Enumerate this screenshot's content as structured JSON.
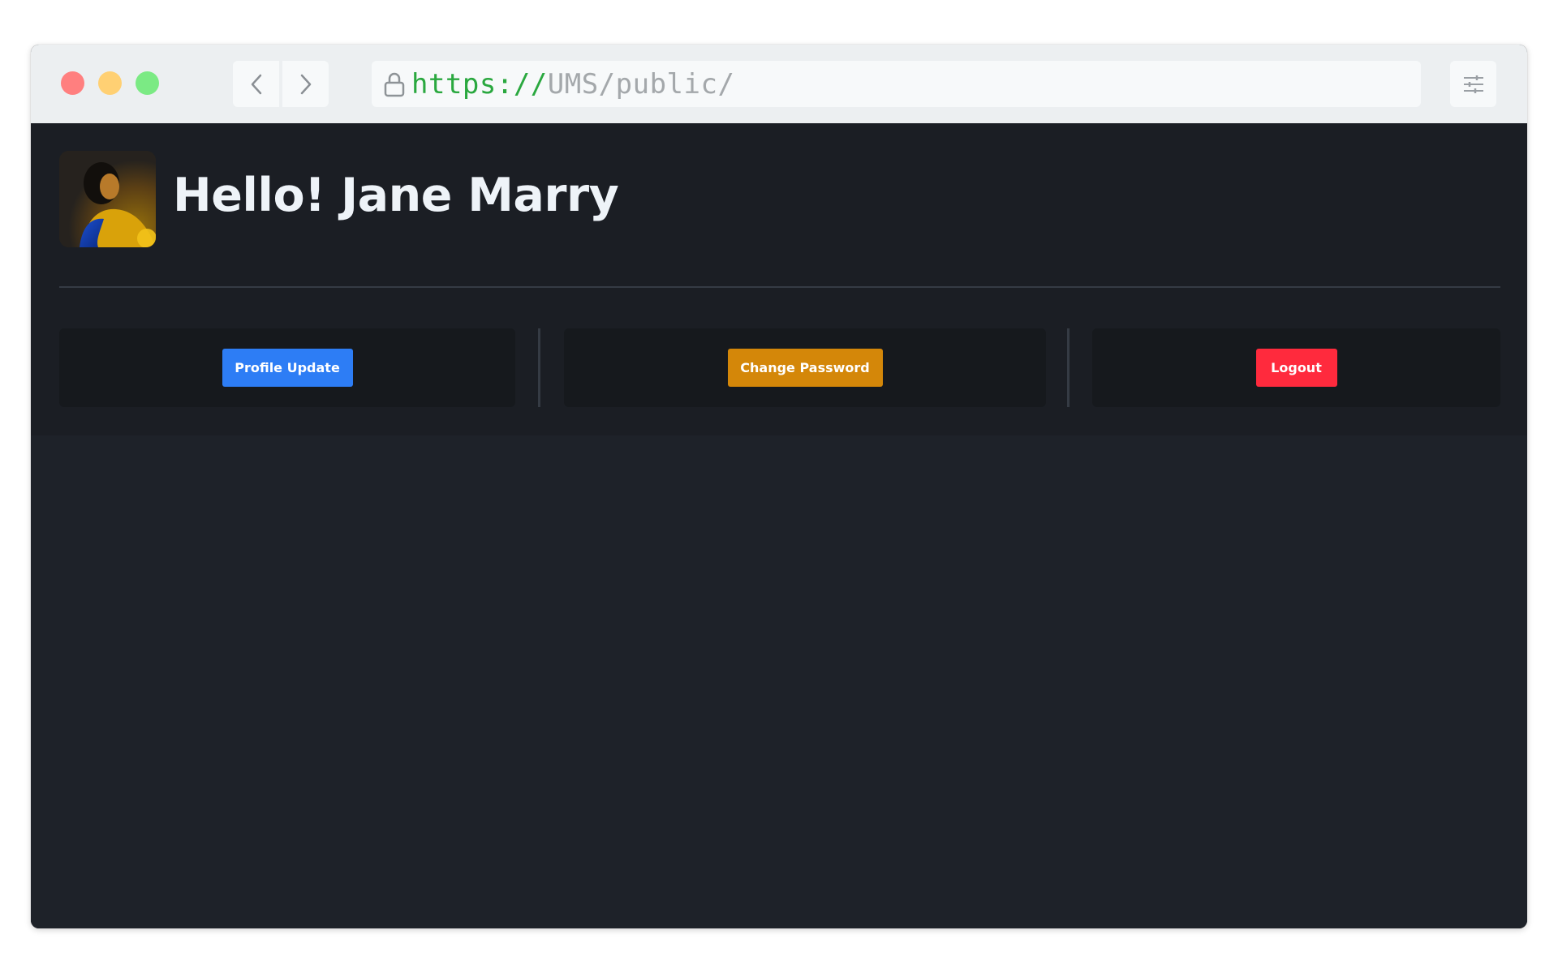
{
  "browser": {
    "url_scheme": "https://",
    "url_path": "UMS/public/",
    "icons": {
      "back": "chevron-left-icon",
      "forward": "chevron-right-icon",
      "lock": "lock-icon",
      "settings": "sliders-icon"
    }
  },
  "header": {
    "greeting": "Hello! Jane Marry",
    "avatar": "user-avatar-photo"
  },
  "actions": {
    "profile_update": "Profile Update",
    "change_password": "Change Password",
    "logout": "Logout"
  },
  "colors": {
    "primary": "#2d7df5",
    "warning": "#d48709",
    "danger": "#ff2a3d",
    "background": "#1e2229"
  }
}
